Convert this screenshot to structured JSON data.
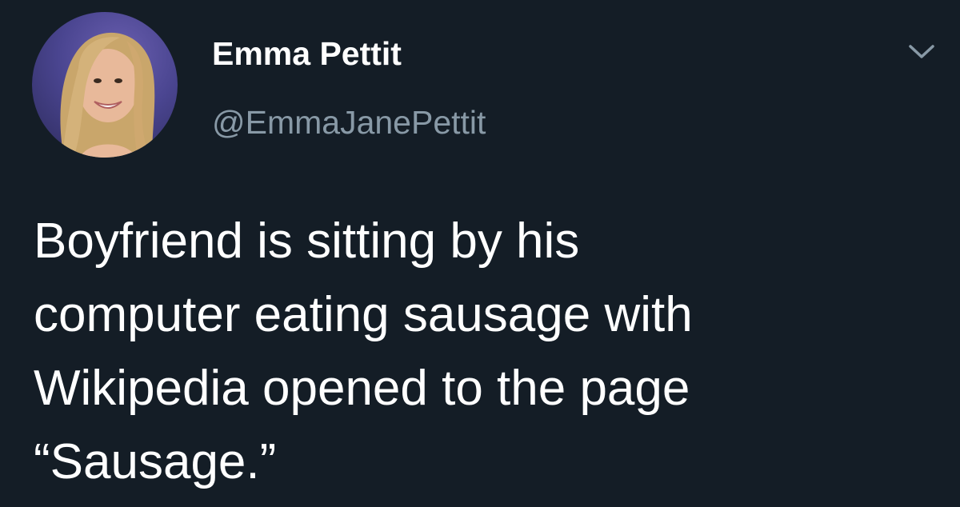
{
  "tweet": {
    "author": {
      "display_name": "Emma Pettit",
      "handle": "@EmmaJanePettit",
      "avatar_icon": "profile-photo"
    },
    "menu_icon": "chevron-down-icon",
    "text": "Boyfriend is sitting by his\ncomputer eating sausage with\nWikipedia opened to the page\n“Sausage.”"
  },
  "colors": {
    "background": "#141d26",
    "primary_text": "#ffffff",
    "secondary_text": "#8899a6"
  }
}
